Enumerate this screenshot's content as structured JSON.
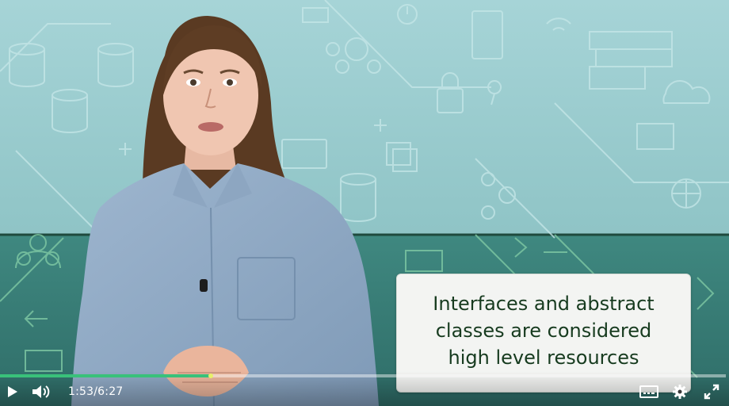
{
  "video": {
    "caption_lines": [
      "Interfaces and abstract",
      "classes are considered",
      "high level resources"
    ]
  },
  "player": {
    "current_time": "1:53",
    "separator": "/",
    "duration": "6:27",
    "progress_fraction": 0.29,
    "accent_color": "#39c17a",
    "icons": [
      "play-icon",
      "volume-icon",
      "captions-icon",
      "settings-icon",
      "fullscreen-icon"
    ]
  }
}
